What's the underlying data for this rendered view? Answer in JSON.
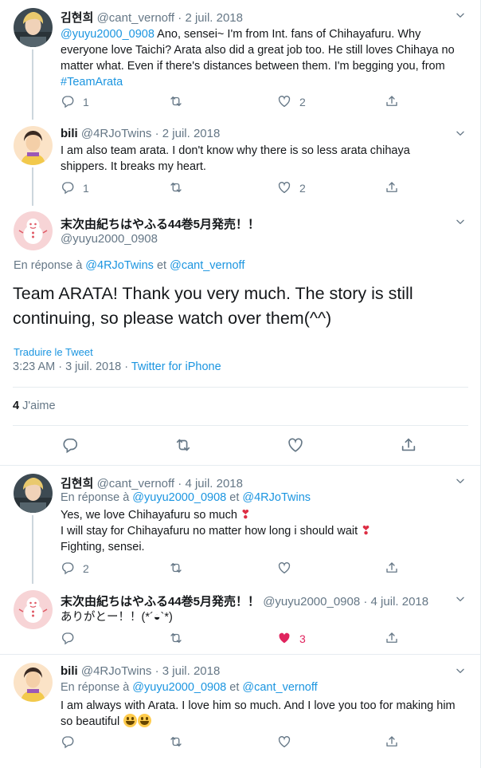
{
  "colors": {
    "accent": "#1b95e0",
    "muted": "#657786",
    "like": "#e0245e",
    "divider": "#e6ecf0",
    "thread": "#ccd6dd"
  },
  "tweets": [
    {
      "name": "김현희",
      "handle": "@cant_vernoff",
      "dot": "·",
      "date": "2 juil. 2018",
      "mention": "@yuyu2000_0908",
      "text1": " Ano, sensei~ I'm from Int. fans of Chihayafuru. Why everyone love Taichi? Arata also did a great job too. He still loves Chihaya no matter what. Even if there's distances between them. I'm begging you, from ",
      "hashtag": "#TeamArata",
      "replies": "1",
      "likes": "2"
    },
    {
      "name": "bili",
      "handle": "@4RJoTwins",
      "dot": "·",
      "date": "2 juil. 2018",
      "text": "I am also team arata. I don't know why there is so less arata chihaya shippers. It breaks my heart.",
      "replies": "1",
      "likes": "2"
    }
  ],
  "focus": {
    "name": "末次由紀ちはやふる44巻5月発売！！",
    "handle": "@yuyu2000_0908",
    "reply_prefix": "En réponse à ",
    "reply_to_1": "@4RJoTwins",
    "reply_and": " et ",
    "reply_to_2": "@cant_vernoff",
    "text": "Team ARATA! Thank you very much. The story is still continuing, so please watch over them(^^)",
    "translate": "Traduire le Tweet",
    "time": "3:23 AM · 3 juil. 2018 · ",
    "source": "Twitter for iPhone",
    "like_count": "4",
    "like_label": " J'aime"
  },
  "replies": [
    {
      "name": "김현희",
      "handle": "@cant_vernoff",
      "dot": "·",
      "date": "4 juil. 2018",
      "reply_prefix": "En réponse à ",
      "reply_to_1": "@yuyu2000_0908",
      "reply_and": " et ",
      "reply_to_2": "@4RJoTwins",
      "line1": "Yes, we love Chihayafuru so much ",
      "line2": "I will stay for Chihayafuru no matter how long i should wait ",
      "line3": "Fighting, sensei.",
      "emoji": "❣",
      "replies": "2"
    },
    {
      "name": "末次由紀ちはやふる44巻5月発売！！",
      "handle": "@yuyu2000_0908",
      "dot": "·",
      "date": "4 juil. 2018",
      "text": "ありがとー！！(*´◒`*)",
      "likes": "3"
    },
    {
      "name": "bili",
      "handle": "@4RJoTwins",
      "dot": "·",
      "date": "3 juil. 2018",
      "reply_prefix": "En réponse à ",
      "reply_to_1": "@yuyu2000_0908",
      "reply_and": " et ",
      "reply_to_2": "@cant_vernoff",
      "text": "I am always with Arata. I love him so much. And I love you too for making him so beautiful "
    }
  ]
}
